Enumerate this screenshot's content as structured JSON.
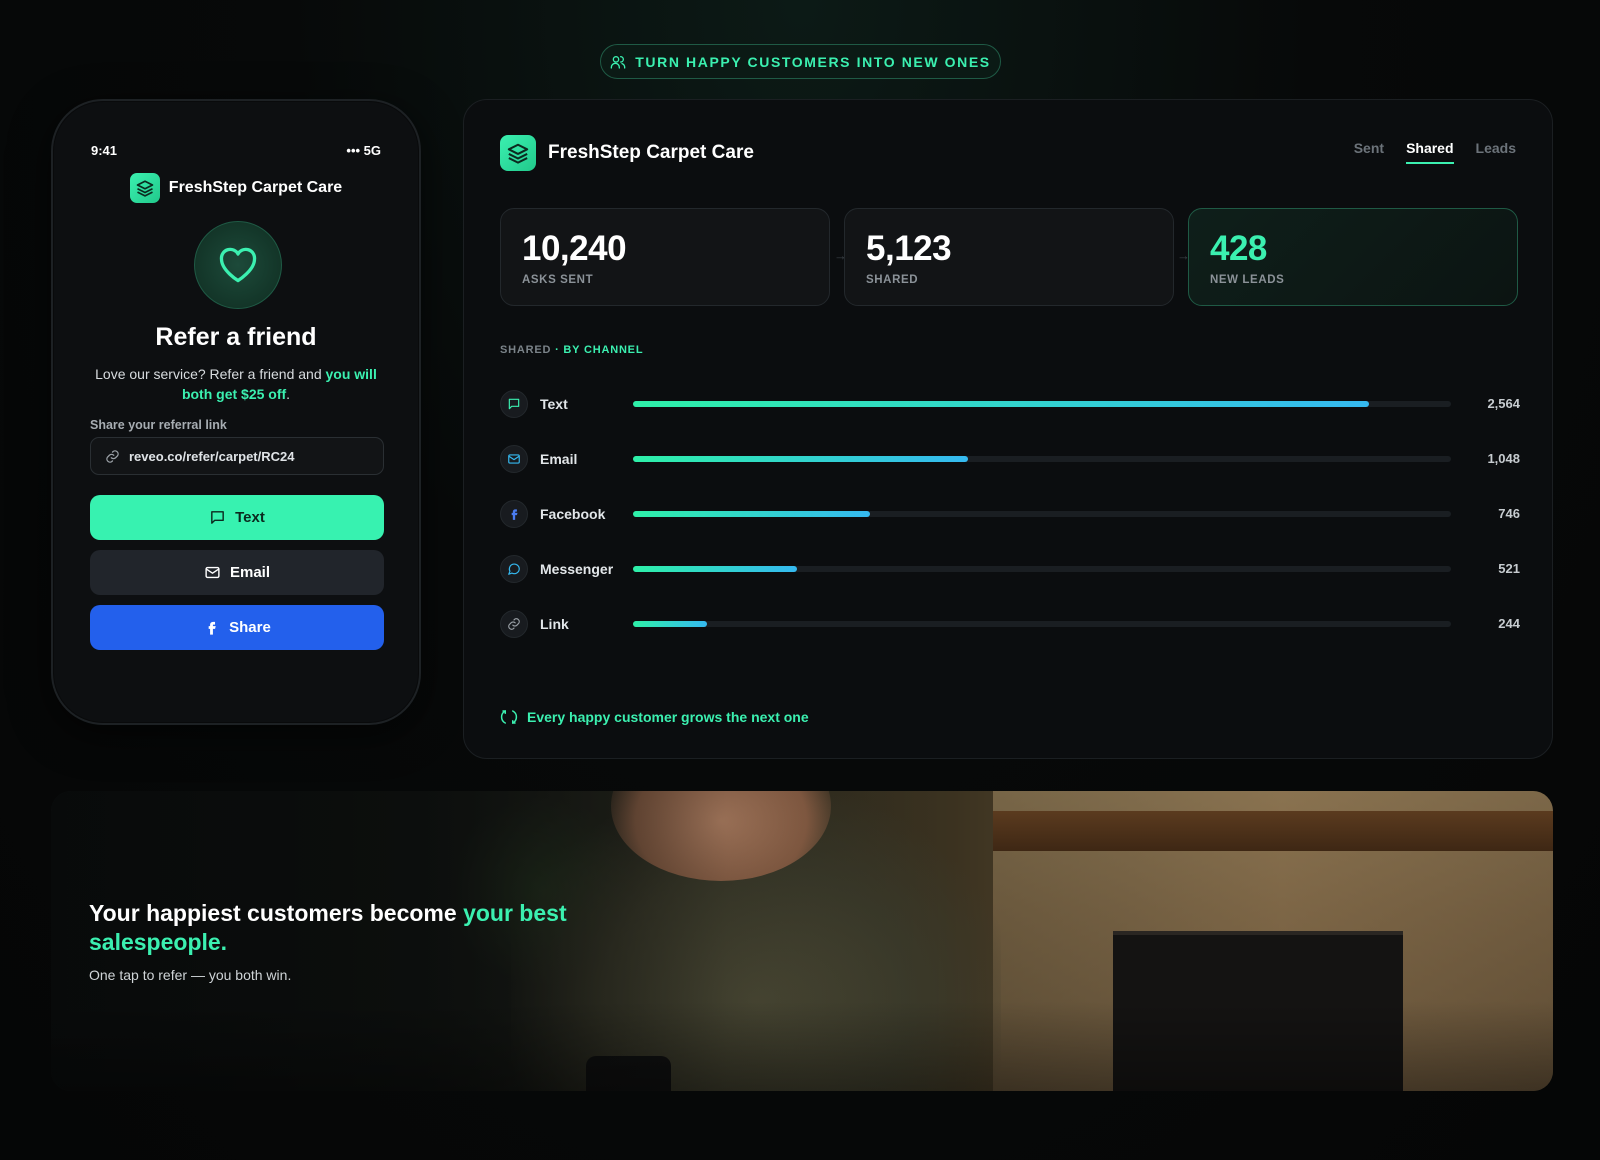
{
  "top_pill": {
    "text": "TURN HAPPY CUSTOMERS INTO NEW ONES",
    "icon": "users-icon"
  },
  "phone": {
    "time": "9:41",
    "signal": "••• 5G",
    "brand": "FreshStep Carpet Care",
    "title": "Refer a friend",
    "desc_prefix": "Love our service? Refer a friend and ",
    "desc_highlight": "you will both get $25 off",
    "desc_suffix": ".",
    "link_label": "Share your referral link",
    "link_value": "reveo.co/refer/carpet/RC24",
    "buttons": {
      "text": "Text",
      "email": "Email",
      "share": "Share"
    }
  },
  "dashboard": {
    "brand": "FreshStep Carpet Care",
    "tabs": [
      {
        "label": "Sent",
        "active": false
      },
      {
        "label": "Shared",
        "active": true
      },
      {
        "label": "Leads",
        "active": false
      }
    ],
    "stats": [
      {
        "value": "10,240",
        "label": "ASKS SENT"
      },
      {
        "value": "5,123",
        "label": "SHARED"
      },
      {
        "value": "428",
        "label": "NEW LEADS"
      }
    ],
    "section_label": "SHARED",
    "section_label_highlight": "· BY CHANNEL",
    "channels": [
      {
        "name": "Text",
        "value": "2,564",
        "fraction": 0.9,
        "icon": "message-square-icon"
      },
      {
        "name": "Email",
        "value": "1,048",
        "fraction": 0.41,
        "icon": "mail-icon"
      },
      {
        "name": "Facebook",
        "value": "746",
        "fraction": 0.29,
        "icon": "facebook-icon"
      },
      {
        "name": "Messenger",
        "value": "521",
        "fraction": 0.2,
        "icon": "message-circle-icon"
      },
      {
        "name": "Link",
        "value": "244",
        "fraction": 0.09,
        "icon": "link-icon"
      }
    ],
    "footer_note": "Every happy customer grows the next one"
  },
  "banner": {
    "title_prefix": "Your happiest customers become ",
    "title_highlight": "your best salespeople.",
    "subtitle": "One tap to refer — you both win."
  },
  "colors": {
    "accent": "#3bf0b0",
    "facebook_blue": "#2360ec",
    "background": "#070909"
  }
}
